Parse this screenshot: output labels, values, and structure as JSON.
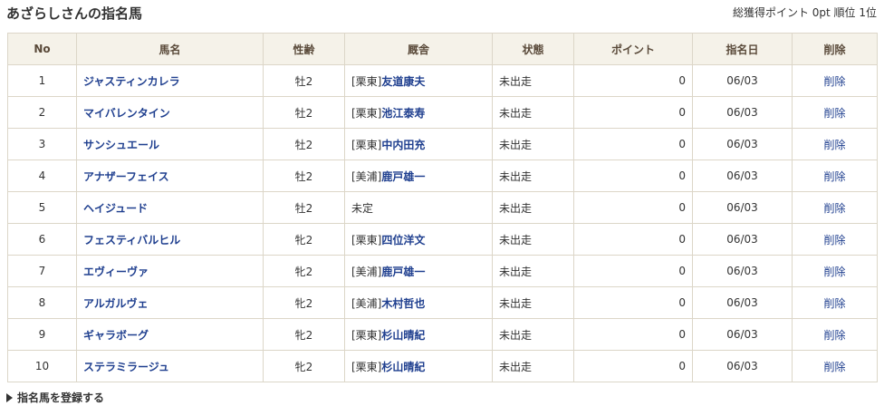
{
  "header": {
    "title": "あざらしさんの指名馬",
    "summary": "総獲得ポイント 0pt 順位 1位"
  },
  "table": {
    "columns": [
      "No",
      "馬名",
      "性齢",
      "厩舎",
      "状態",
      "ポイント",
      "指名日",
      "削除"
    ],
    "rows": [
      {
        "no": "1",
        "name": "ジャスティンカレラ",
        "sexage": "牡2",
        "stable_prefix": "[栗東]",
        "trainer": "友道康夫",
        "status": "未出走",
        "points": "0",
        "date": "06/03",
        "delete": "削除"
      },
      {
        "no": "2",
        "name": "マイバレンタイン",
        "sexage": "牡2",
        "stable_prefix": "[栗東]",
        "trainer": "池江泰寿",
        "status": "未出走",
        "points": "0",
        "date": "06/03",
        "delete": "削除"
      },
      {
        "no": "3",
        "name": "サンシュエール",
        "sexage": "牡2",
        "stable_prefix": "[栗東]",
        "trainer": "中内田充",
        "status": "未出走",
        "points": "0",
        "date": "06/03",
        "delete": "削除"
      },
      {
        "no": "4",
        "name": "アナザーフェイス",
        "sexage": "牡2",
        "stable_prefix": "[美浦]",
        "trainer": "鹿戸雄一",
        "status": "未出走",
        "points": "0",
        "date": "06/03",
        "delete": "削除"
      },
      {
        "no": "5",
        "name": "ヘイジュード",
        "sexage": "牡2",
        "stable_prefix": "",
        "trainer": "",
        "stable_plain": "未定",
        "status": "未出走",
        "points": "0",
        "date": "06/03",
        "delete": "削除"
      },
      {
        "no": "6",
        "name": "フェスティバルヒル",
        "sexage": "牝2",
        "stable_prefix": "[栗東]",
        "trainer": "四位洋文",
        "status": "未出走",
        "points": "0",
        "date": "06/03",
        "delete": "削除"
      },
      {
        "no": "7",
        "name": "エヴィーヴァ",
        "sexage": "牝2",
        "stable_prefix": "[美浦]",
        "trainer": "鹿戸雄一",
        "status": "未出走",
        "points": "0",
        "date": "06/03",
        "delete": "削除"
      },
      {
        "no": "8",
        "name": "アルガルヴェ",
        "sexage": "牝2",
        "stable_prefix": "[美浦]",
        "trainer": "木村哲也",
        "status": "未出走",
        "points": "0",
        "date": "06/03",
        "delete": "削除"
      },
      {
        "no": "9",
        "name": "ギャラボーグ",
        "sexage": "牝2",
        "stable_prefix": "[栗東]",
        "trainer": "杉山晴紀",
        "status": "未出走",
        "points": "0",
        "date": "06/03",
        "delete": "削除"
      },
      {
        "no": "10",
        "name": "ステラミラージュ",
        "sexage": "牝2",
        "stable_prefix": "[栗東]",
        "trainer": "杉山晴紀",
        "status": "未出走",
        "points": "0",
        "date": "06/03",
        "delete": "削除"
      }
    ]
  },
  "footer": {
    "register_label": "指名馬を登録する"
  },
  "colors": {
    "header_bg": "#f5f2e9",
    "border": "#dcd6c8",
    "link": "#1f3f8f"
  }
}
